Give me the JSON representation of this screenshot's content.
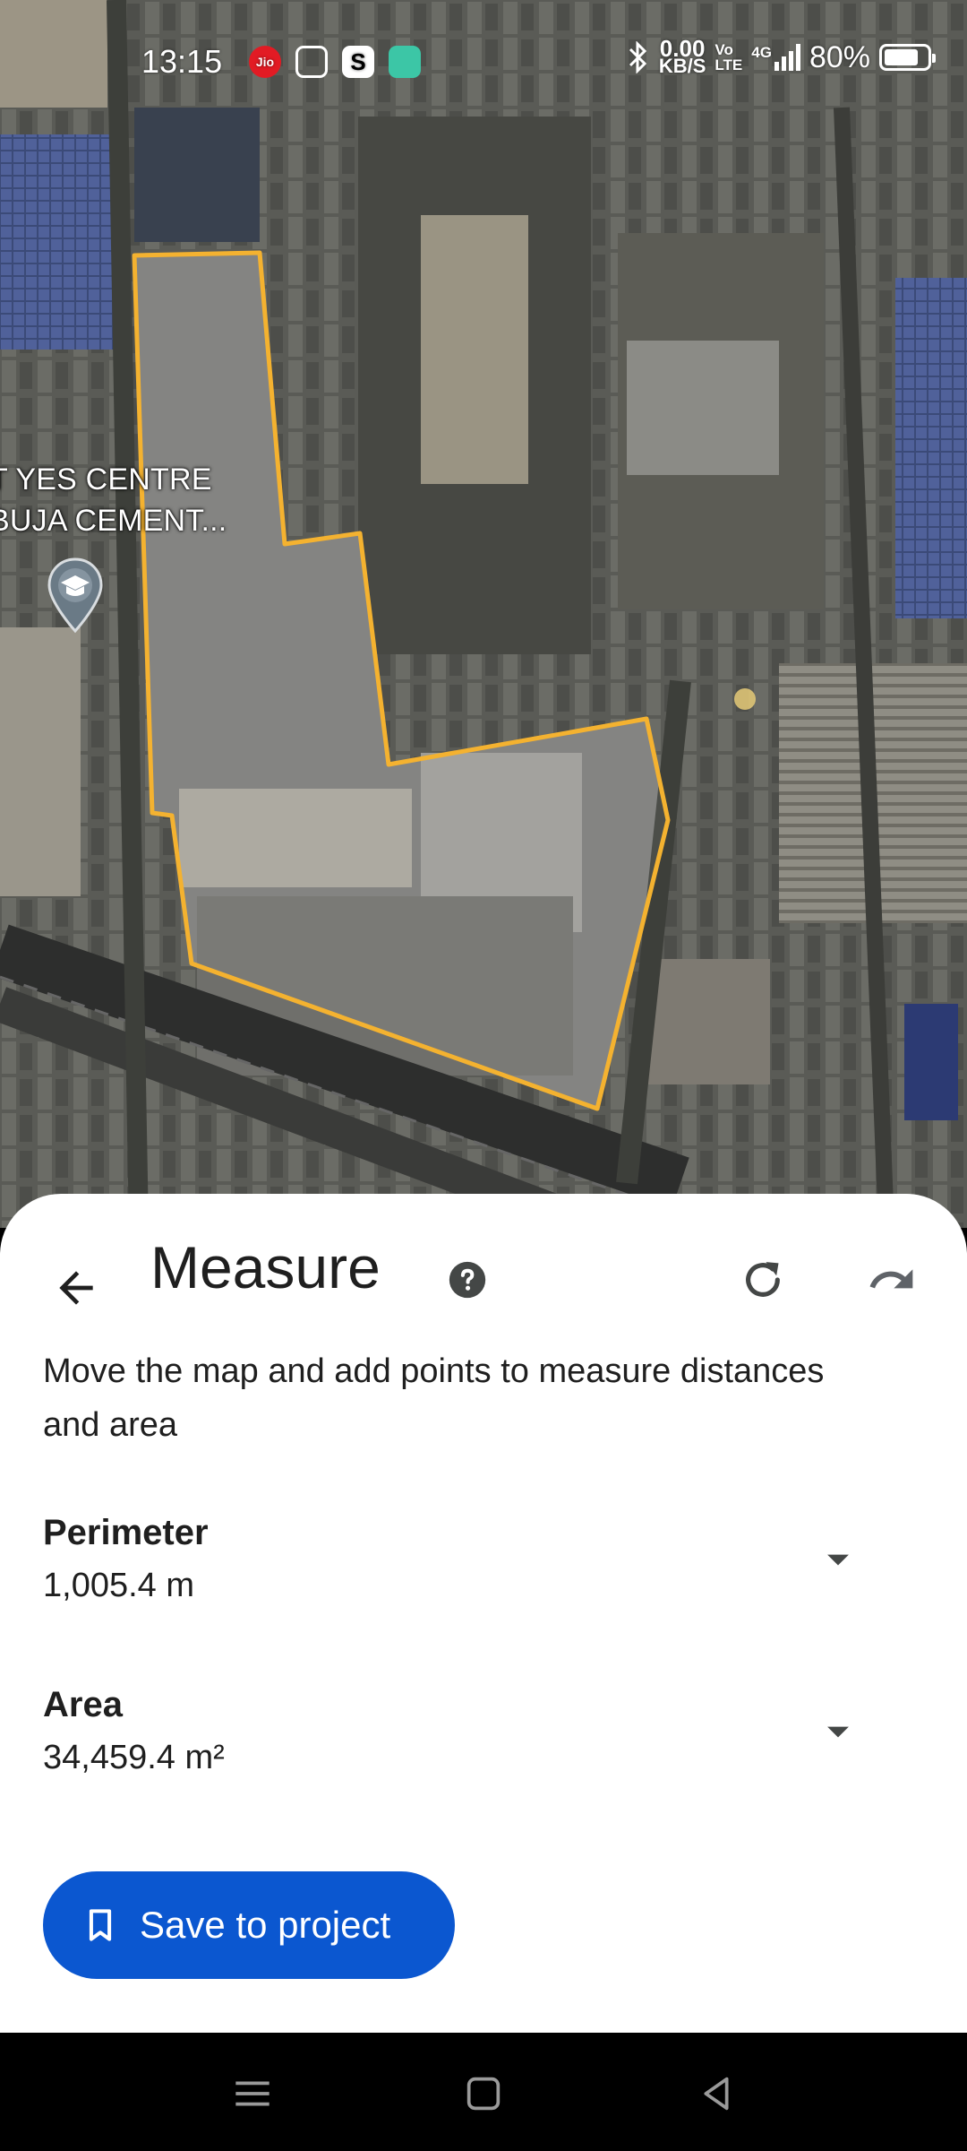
{
  "status_bar": {
    "time": "13:15",
    "notification_icons": [
      "jio-icon",
      "calculator-icon",
      "s-app-icon",
      "chat-app-icon"
    ],
    "net_speed_value": "0.00",
    "net_speed_unit": "KB/S",
    "volte_top": "Vo",
    "volte_bottom": "LTE",
    "network_type": "4G",
    "battery_percent": "80%",
    "battery_level": 0.8
  },
  "map": {
    "labels": [
      "T YES CENTRE",
      "BUJA CEMENT..."
    ],
    "outline_color": "#f4b230",
    "poi_icon": "school-pin-icon"
  },
  "sheet": {
    "title": "Measure",
    "instruction": "Move the map and add points to measure distances and area",
    "perimeter": {
      "label": "Perimeter",
      "value": "1,005.4 m"
    },
    "area": {
      "label": "Area",
      "value": "34,459.4 m²"
    },
    "save_button": {
      "label": "Save to project",
      "color": "#0b57d0"
    }
  },
  "icons": {
    "back": "arrow-back-icon",
    "help": "help-circle-icon",
    "redo": "redo-icon",
    "undo": "undo-icon",
    "bookmark": "bookmark-icon",
    "dropdown": "chevron-down-icon"
  }
}
